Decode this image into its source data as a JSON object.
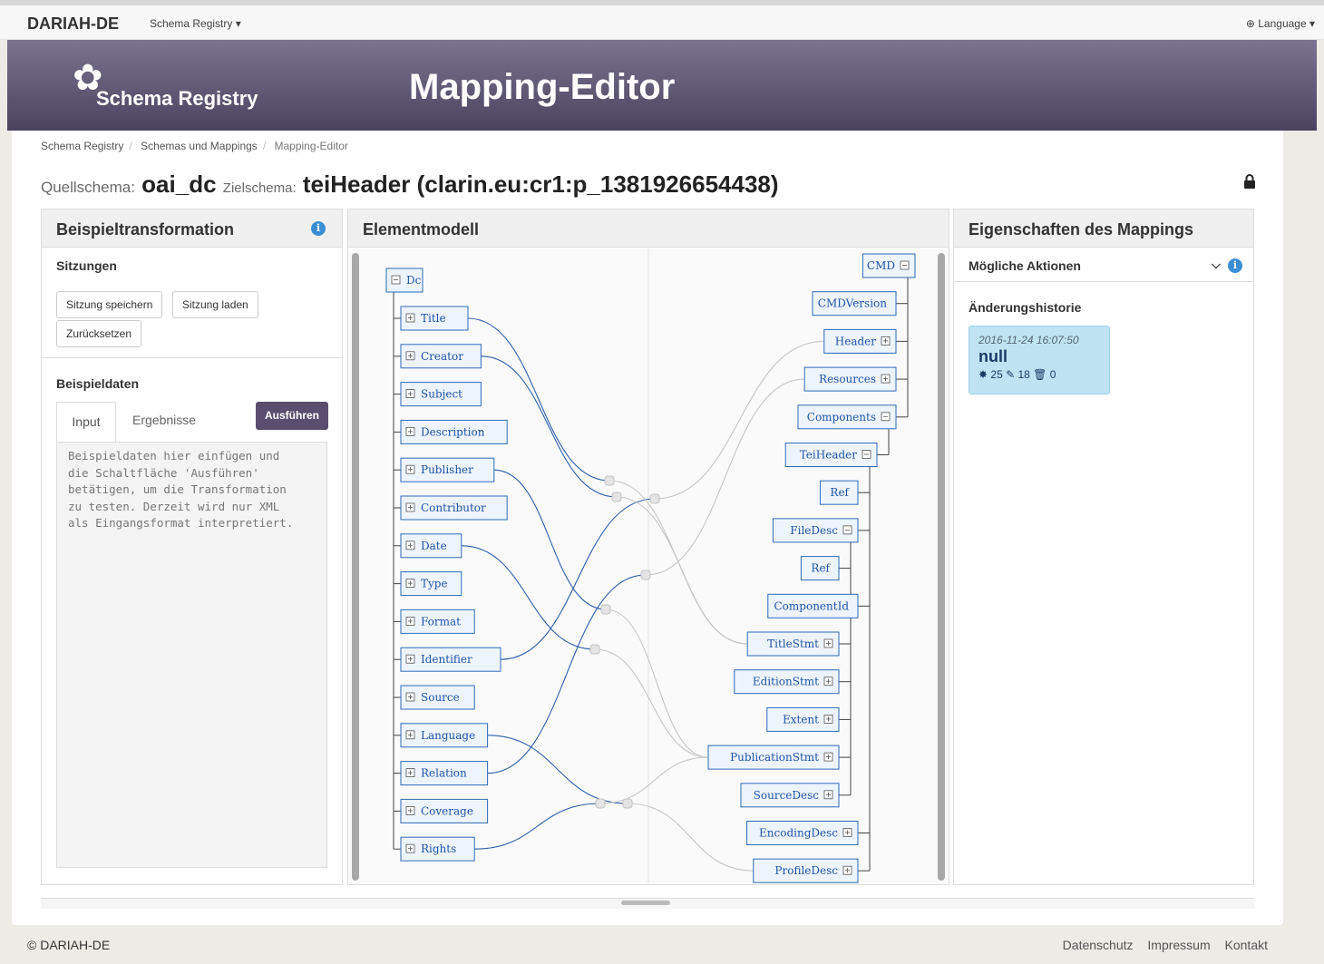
{
  "navbar": {
    "brand": "DARIAH-DE",
    "menu": "Schema Registry ▾",
    "language": "⊕ Language ▾"
  },
  "banner": {
    "logo_text": "Schema Registry",
    "title": "Mapping-Editor"
  },
  "breadcrumb": [
    "Schema Registry",
    "Schemas und Mappings",
    "Mapping-Editor"
  ],
  "schema": {
    "source_label": "Quellschema:",
    "source": "oai_dc",
    "target_label": "Zielschema:",
    "target": "teiHeader (clarin.eu:cr1:p_1381926654438)"
  },
  "left_panel": {
    "title": "Beispieltransformation",
    "sessions_heading": "Sitzungen",
    "buttons": {
      "save": "Sitzung speichern",
      "load": "Sitzung laden",
      "reset": "Zurücksetzen"
    },
    "sample_heading": "Beispieldaten",
    "tabs": {
      "input": "Input",
      "results": "Ergebnisse"
    },
    "run": "Ausführen",
    "textarea": "Beispieldaten hier einfügen und\ndie Schaltfläche 'Ausführen'\nbetätigen, um die Transformation\nzu testen. Derzeit wird nur XML\nals Eingangsformat interpretiert."
  },
  "middle_panel": {
    "title": "Elementmodell",
    "source_root": "Dc",
    "source_children": [
      "Title",
      "Creator",
      "Subject",
      "Description",
      "Publisher",
      "Contributor",
      "Date",
      "Type",
      "Format",
      "Identifier",
      "Source",
      "Language",
      "Relation",
      "Coverage",
      "Rights"
    ],
    "target_nodes": [
      "CMD",
      "CMDVersion",
      "Header",
      "Resources",
      "Components",
      "TeiHeader",
      "Ref",
      "FileDesc",
      "Ref",
      "ComponentId",
      "TitleStmt",
      "EditionStmt",
      "Extent",
      "PublicationStmt",
      "SourceDesc",
      "EncodingDesc",
      "ProfileDesc"
    ]
  },
  "right_panel": {
    "title": "Eigenschaften des Mappings",
    "actions": "Mögliche Aktionen",
    "history_heading": "Änderungshistorie",
    "history": {
      "date": "2016-11-24 16:07:50",
      "title": "null",
      "stats": "✸ 25  ✎ 18  🗑 0"
    }
  },
  "footer": {
    "copyright": "© DARIAH-DE",
    "links": [
      "Datenschutz",
      "Impressum",
      "Kontakt"
    ]
  }
}
